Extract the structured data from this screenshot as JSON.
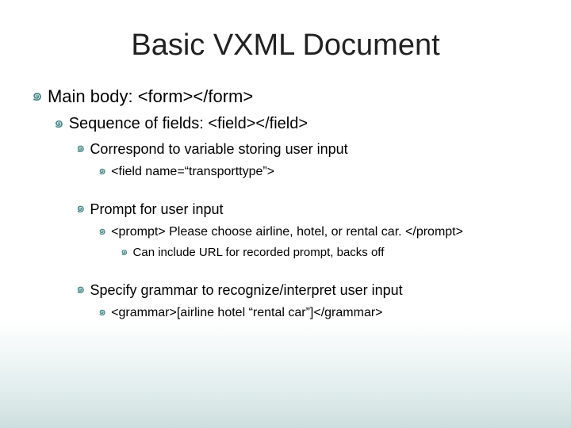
{
  "title": "Basic VXML Document",
  "bullets": [
    {
      "level": 0,
      "text": "Main body: <form></form>"
    },
    {
      "level": 1,
      "text": "Sequence of fields: <field></field>"
    },
    {
      "level": 2,
      "text": "Correspond to variable storing user input"
    },
    {
      "level": 3,
      "text": "<field name=“transporttype”>"
    },
    {
      "level": 2,
      "gapBefore": true,
      "text": "Prompt for user input"
    },
    {
      "level": 3,
      "text": "<prompt> Please choose airline, hotel, or rental car. </prompt>"
    },
    {
      "level": 4,
      "text": "Can include URL for recorded prompt, backs off"
    },
    {
      "level": 2,
      "gapBefore": true,
      "text": "Specify grammar to recognize/interpret user input"
    },
    {
      "level": 3,
      "text": "<grammar>[airline hotel “rental car”]</grammar>"
    }
  ],
  "bulletGlyph": "๑"
}
